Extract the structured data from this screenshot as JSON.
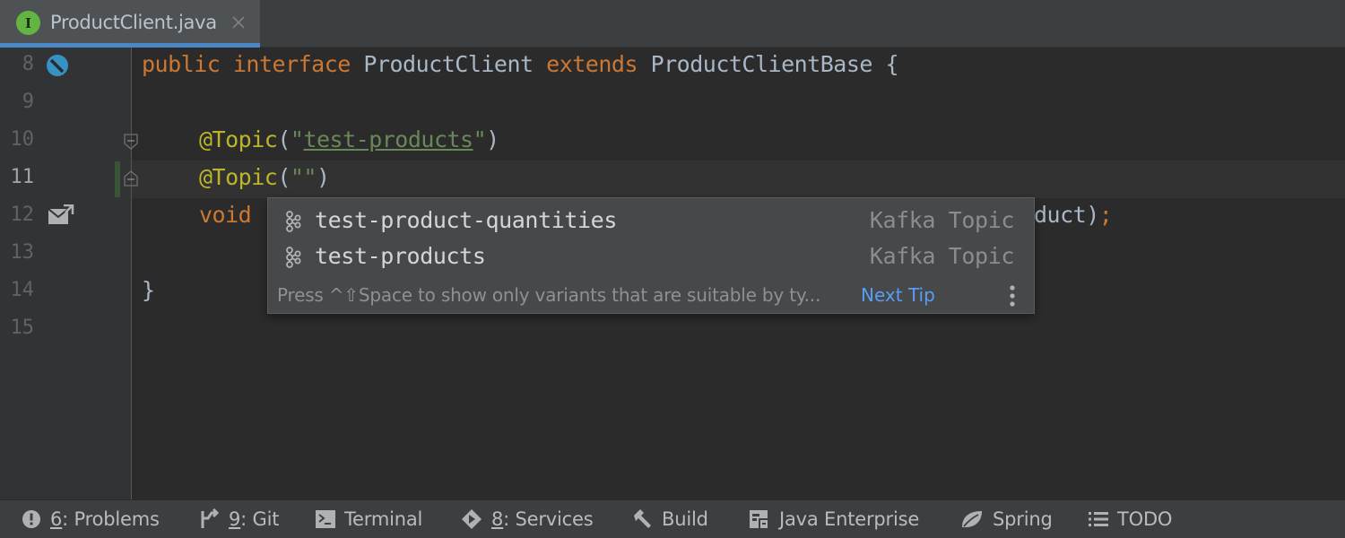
{
  "tab": {
    "icon_letter": "I",
    "label": "ProductClient.java"
  },
  "gutter": {
    "line_numbers": [
      "8",
      "9",
      "10",
      "11",
      "12",
      "13",
      "14",
      "15"
    ]
  },
  "code": {
    "line8": {
      "kw1": "public",
      "kw2": "interface",
      "name": "ProductClient",
      "kw3": "extends",
      "base": "ProductClientBase",
      "brace": "{"
    },
    "line10": {
      "ann": "@Topic",
      "open": "(",
      "q1": "\"",
      "str": "test-products",
      "q2": "\"",
      "close": ")"
    },
    "line11": {
      "ann": "@Topic",
      "open": "(",
      "str": "\"\"",
      "close": ")"
    },
    "line12": {
      "kw": "void",
      "tail": "duct)",
      "semi": ";"
    },
    "line14": {
      "brace": "}"
    }
  },
  "completion": {
    "items": [
      {
        "label": "test-product-quantities",
        "type": "Kafka Topic"
      },
      {
        "label": "test-products",
        "type": "Kafka Topic"
      }
    ],
    "hint": "Press ^⇧Space to show only variants that are suitable by ty...",
    "next_tip": "Next Tip"
  },
  "toolbar": {
    "problems": {
      "mnemonic": "6",
      "label": ": Problems"
    },
    "git": {
      "mnemonic": "9",
      "label": ": Git"
    },
    "terminal": {
      "label": "Terminal"
    },
    "services": {
      "mnemonic": "8",
      "label": ": Services"
    },
    "build": {
      "label": "Build"
    },
    "java_enterprise": {
      "label": "Java Enterprise"
    },
    "spring": {
      "label": "Spring"
    },
    "todo": {
      "label": "TODO"
    }
  },
  "colors": {
    "keyword": "#cc7832",
    "annotation": "#bbb529",
    "string": "#6a8759",
    "accent": "#589df6"
  }
}
